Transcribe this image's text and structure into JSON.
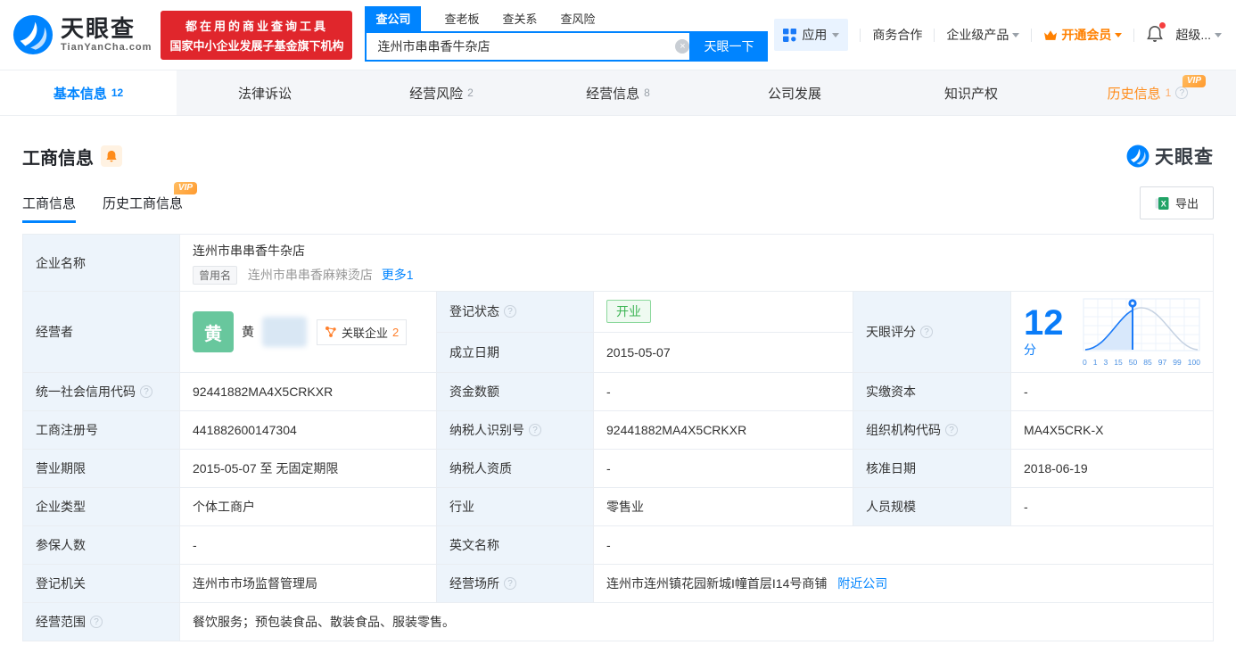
{
  "header": {
    "brand": "天眼查",
    "brand_domain": "TianYanCha.com",
    "promo_line1": "都在用的商业查询工具",
    "promo_line2": "国家中小企业发展子基金旗下机构",
    "search_tabs": [
      {
        "label": "查公司"
      },
      {
        "label": "查老板"
      },
      {
        "label": "查关系"
      },
      {
        "label": "查风险"
      }
    ],
    "search_value": "连州市串串香牛杂店",
    "search_button": "天眼一下",
    "nav_apps": "应用",
    "nav_biz": "商务合作",
    "nav_enterprise": "企业级产品",
    "nav_vip": "开通会员",
    "nav_super": "超级..."
  },
  "page_tabs": [
    {
      "label": "基本信息",
      "count": "12"
    },
    {
      "label": "法律诉讼",
      "count": ""
    },
    {
      "label": "经营风险",
      "count": "2"
    },
    {
      "label": "经营信息",
      "count": "8"
    },
    {
      "label": "公司发展",
      "count": ""
    },
    {
      "label": "知识产权",
      "count": ""
    },
    {
      "label": "历史信息",
      "count": "1",
      "vip": "VIP"
    }
  ],
  "section": {
    "title": "工商信息",
    "watermark_brand": "天眼查",
    "subtab_active": "工商信息",
    "subtab_history": "历史工商信息",
    "vip_badge": "VIP",
    "export_label": "导出"
  },
  "info": {
    "name_label": "企业名称",
    "name": "连州市串串香牛杂店",
    "former_tag": "曾用名",
    "former_name": "连州市串串香麻辣烫店",
    "more_link": "更多1",
    "operator_label": "经营者",
    "avatar_char": "黄",
    "operator_first": "黄",
    "related_label": "关联企业",
    "related_count": "2",
    "reg_status_label": "登记状态",
    "reg_status": "开业",
    "est_date_label": "成立日期",
    "est_date": "2015-05-07",
    "score_label": "天眼评分",
    "score_value": "12",
    "score_unit": "分",
    "uscc_label": "统一社会信用代码",
    "uscc": "92441882MA4X5CRKXR",
    "capital_label": "资金数额",
    "capital": "-",
    "paid_label": "实缴资本",
    "paid": "-",
    "regno_label": "工商注册号",
    "regno": "441882600147304",
    "taxid_label": "纳税人识别号",
    "taxid": "92441882MA4X5CRKXR",
    "orgcode_label": "组织机构代码",
    "orgcode": "MA4X5CRK-X",
    "term_label": "营业期限",
    "term": "2015-05-07 至 无固定期限",
    "taxq_label": "纳税人资质",
    "taxq": "-",
    "approve_label": "核准日期",
    "approve": "2018-06-19",
    "type_label": "企业类型",
    "type": "个体工商户",
    "industry_label": "行业",
    "industry": "零售业",
    "staff_label": "人员规模",
    "staff": "-",
    "insured_label": "参保人数",
    "insured": "-",
    "en_label": "英文名称",
    "en": "-",
    "authority_label": "登记机关",
    "authority": "连州市市场监督管理局",
    "site_label": "经营场所",
    "site": "连州市连州镇花园新城I幢首层I14号商铺",
    "nearby_link": "附近公司",
    "scope_label": "经营范围",
    "scope": "餐饮服务；预包装食品、散装食品、服装零售。"
  },
  "chart_data": {
    "type": "area",
    "title": "天眼评分分布曲线",
    "score": 12,
    "x_ticks": [
      "0",
      "1",
      "3",
      "15",
      "50",
      "85",
      "97",
      "99",
      "100"
    ],
    "marker_position": "score 12, between ticks 3 and 15",
    "curve": "normal distribution, peak at tick 50, left tail filled blue up to marker",
    "accent_color": "#1a7af8"
  },
  "colors": {
    "brand_blue": "#0084ff",
    "orange": "#ff8c1a",
    "promo_red": "#e0262c",
    "open_green": "#3cb454",
    "label_bg": "#edf4fb"
  }
}
